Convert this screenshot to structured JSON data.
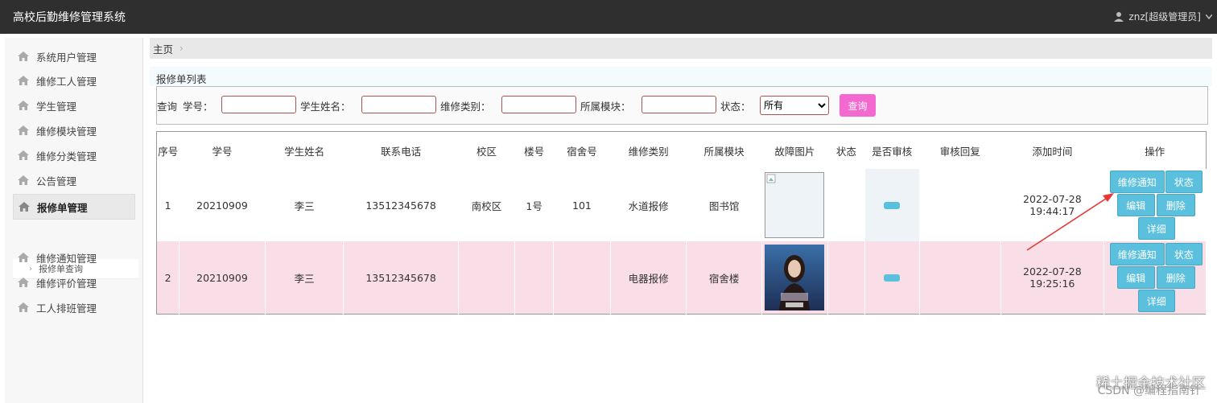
{
  "app": {
    "title": "高校后勤维修管理系统",
    "user_label": "znz[超级管理员]"
  },
  "sidebar": {
    "items": [
      {
        "label": "系统用户管理"
      },
      {
        "label": "维修工人管理"
      },
      {
        "label": "学生管理"
      },
      {
        "label": "维修模块管理"
      },
      {
        "label": "维修分类管理"
      },
      {
        "label": "公告管理"
      },
      {
        "label": "报修单管理"
      },
      {
        "label": "维修通知管理"
      },
      {
        "label": "维修评价管理"
      },
      {
        "label": "工人排班管理"
      }
    ],
    "sub_item": "报修单查询"
  },
  "breadcrumb": {
    "home": "主页",
    "separator": "›"
  },
  "panel": {
    "title": "报修单列表"
  },
  "search": {
    "prefix": "查询",
    "student_no_label": "学号：",
    "student_name_label": "学生姓名：",
    "repair_type_label": "维修类别：",
    "module_label": "所属模块：",
    "status_label": "状态：",
    "status_value": "所有",
    "button": "查询"
  },
  "table": {
    "headers": [
      "序号",
      "学号",
      "学生姓名",
      "联系电话",
      "校区",
      "楼号",
      "宿舍号",
      "维修类别",
      "所属模块",
      "故障图片",
      "状态",
      "是否审核",
      "审核回复",
      "添加时间",
      "操作"
    ],
    "rows": [
      {
        "idx": "1",
        "student_no": "20210909",
        "name": "李三",
        "phone": "13512345678",
        "campus": "南校区",
        "building": "1号",
        "room": "101",
        "type": "水道报修",
        "module": "图书馆",
        "status": "",
        "reply": "",
        "time": "2022-07-28 19:44:17"
      },
      {
        "idx": "2",
        "student_no": "20210909",
        "name": "李三",
        "phone": "13512345678",
        "campus": "",
        "building": "",
        "room": "",
        "type": "电器报修",
        "module": "宿舍楼",
        "status": "",
        "reply": "",
        "time": "2022-07-28 19:25:16"
      }
    ],
    "ops": {
      "notify": "维修通知",
      "status": "状态",
      "edit": "编辑",
      "delete": "删除",
      "detail": "详细"
    }
  },
  "watermark": {
    "text1": "稀土掘金技术社区",
    "text2": "CSDN @编程指南针"
  },
  "colors": {
    "topbar": "#2f2f2f",
    "accent": "#5bc0de",
    "search_button": "#f469d0",
    "row_alt": "#f9dde7",
    "arrow": "#e53935"
  }
}
